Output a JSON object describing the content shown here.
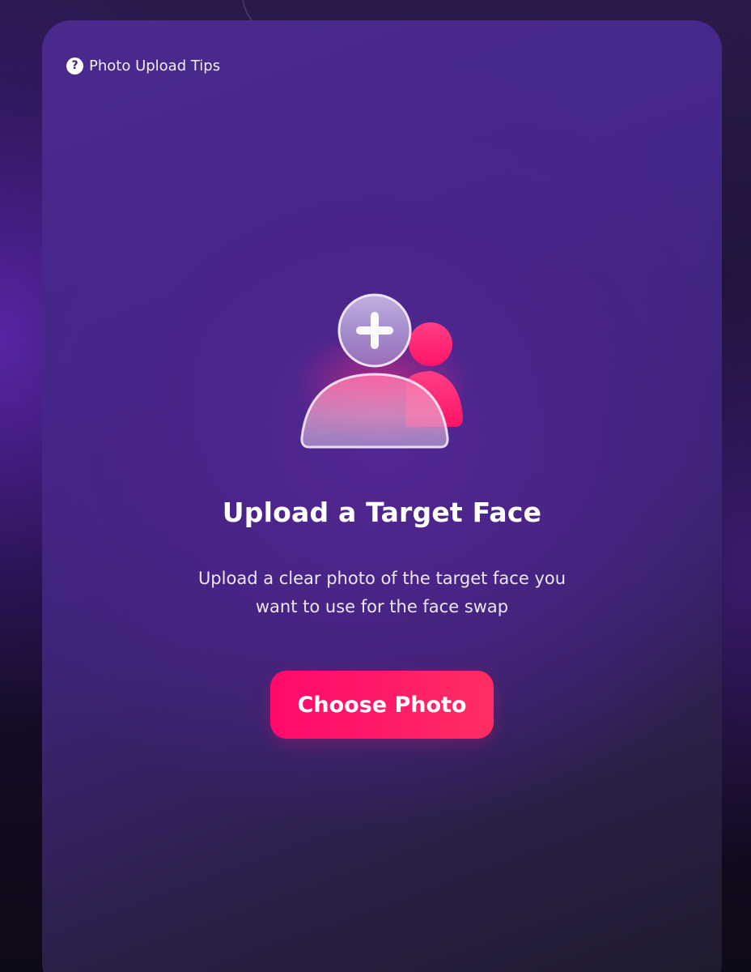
{
  "tips": {
    "icon": "question-circle-icon",
    "label": "Photo Upload Tips"
  },
  "illustration": {
    "icon": "add-user-icon"
  },
  "main": {
    "title": "Upload a Target Face",
    "description": "Upload a clear photo of the target face you want to use for the face swap",
    "button_label": "Choose Photo"
  },
  "colors": {
    "accent": "#ff1a68",
    "card_background": "#45268a",
    "page_background": "#140c24"
  }
}
